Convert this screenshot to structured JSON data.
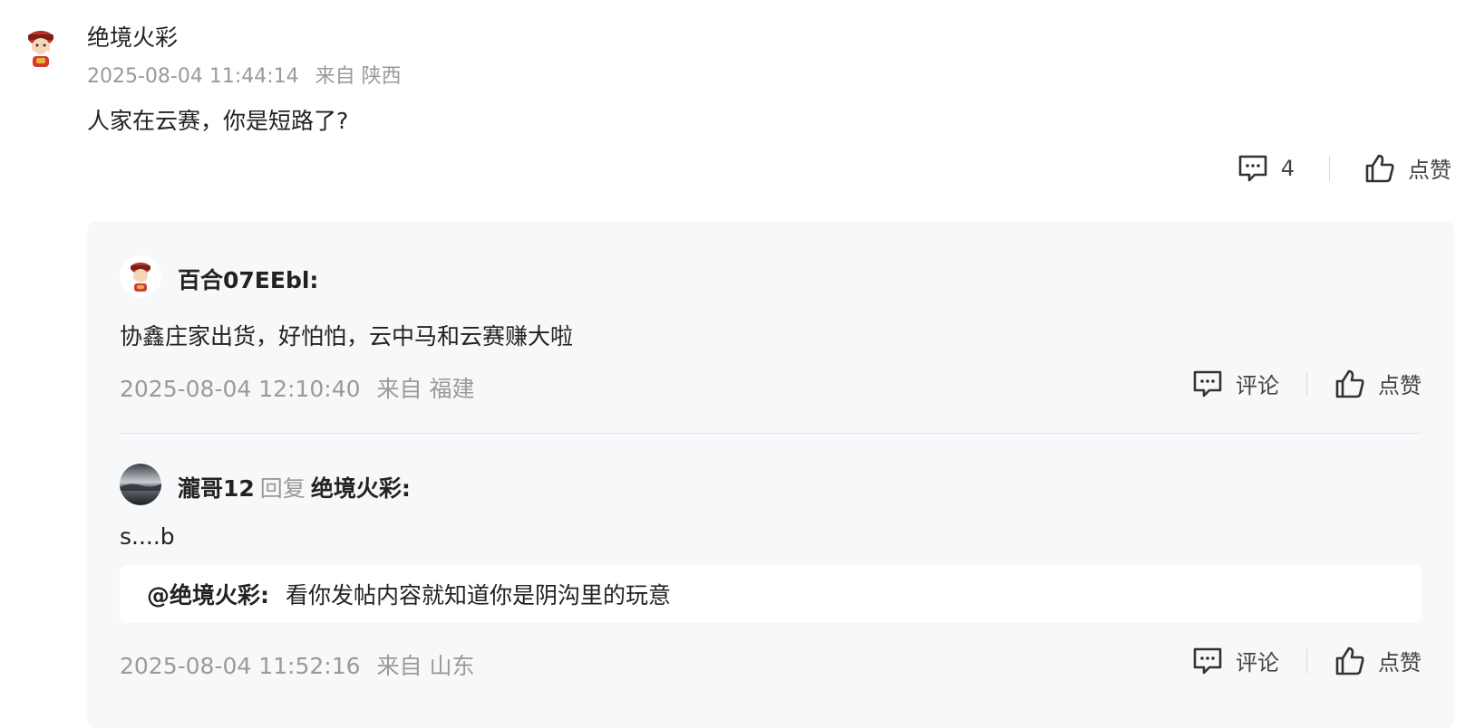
{
  "main_comment": {
    "username": "绝境火彩",
    "timestamp": "2025-08-04 11:44:14",
    "location": "来自 陕西",
    "text": "人家在云赛，你是短路了?",
    "reply_count": "4",
    "like_label": "点赞"
  },
  "replies": [
    {
      "username": "百合07EEbl:",
      "text": "协鑫庄家出货，好怕怕，云中马和云赛赚大啦",
      "timestamp": "2025-08-04 12:10:40",
      "location": "来自 福建",
      "comment_label": "评论",
      "like_label": "点赞"
    },
    {
      "username": "瀧哥12",
      "reply_word": "回复",
      "reply_target": "绝境火彩:",
      "text": "s....b",
      "quote_at": "@绝境火彩:",
      "quote_text": "看你发帖内容就知道你是阴沟里的玩意",
      "timestamp": "2025-08-04 11:52:16",
      "location": "来自 山东",
      "comment_label": "评论",
      "like_label": "点赞"
    }
  ],
  "icons": {
    "comment": "comment-bubble-icon",
    "like": "thumbs-up-icon"
  }
}
